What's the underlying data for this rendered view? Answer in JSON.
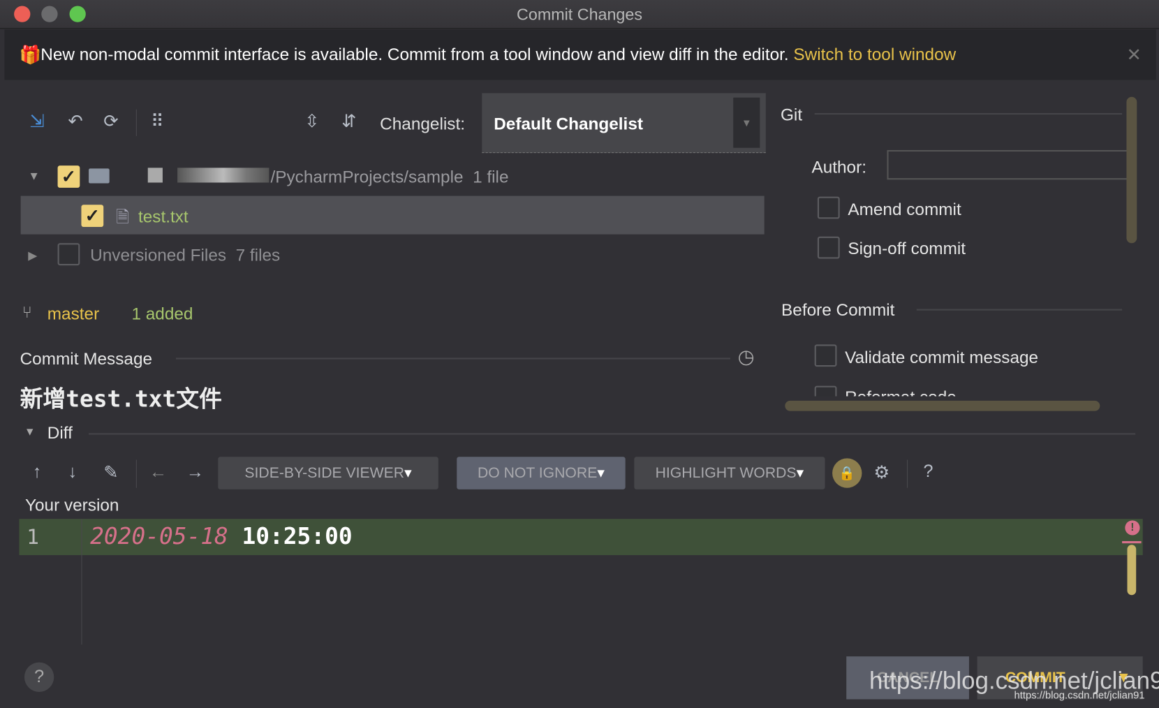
{
  "window": {
    "title": "Commit Changes"
  },
  "banner": {
    "text": "New non-modal commit interface is available. Commit from a tool window and view diff in the editor.",
    "link": "Switch to tool window"
  },
  "toolbar": {
    "changelist_label": "Changelist:",
    "changelist_value": "Default Changelist"
  },
  "tree": {
    "root_path": "/PycharmProjects/sample",
    "root_count": "1 file",
    "file": "test.txt",
    "unversioned": "Unversioned Files",
    "unversioned_count": "7 files"
  },
  "status": {
    "branch": "master",
    "added": "1 added"
  },
  "commit_message": {
    "label": "Commit Message",
    "value": "新增test.txt文件"
  },
  "git": {
    "heading": "Git",
    "author_label": "Author:",
    "author_value": "",
    "amend": "Amend commit",
    "signoff": "Sign-off commit"
  },
  "before_commit": {
    "heading": "Before Commit",
    "validate": "Validate commit message",
    "reformat": "Reformat code"
  },
  "diff": {
    "label": "Diff",
    "viewer": "SIDE-BY-SIDE VIEWER",
    "ignore": "DO NOT IGNORE",
    "highlight": "HIGHLIGHT WORDS",
    "help": "?",
    "your_version": "Your version",
    "line_number": "1",
    "line_date": "2020-05-18",
    "line_time": "10:25:00"
  },
  "footer": {
    "help": "?",
    "cancel": "CANCEL",
    "commit": "COMMIT",
    "watermark": "https://blog.csdn.net/jclian91",
    "watermark_small": "https://blog.csdn.net/jclian91"
  },
  "colors": {
    "accent": "#e8c24a",
    "checkbox": "#efd27a",
    "added_line": "#3f5139",
    "date": "#d6708a"
  }
}
